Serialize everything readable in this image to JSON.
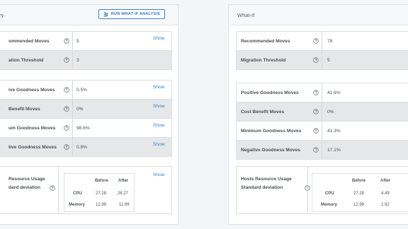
{
  "left": {
    "title": "ry",
    "run_button": "RUN WHAT-IF ANALYSIS",
    "show": "Show",
    "rows1": [
      {
        "label": "ommended Moves",
        "value": "5"
      },
      {
        "label": "ation Threshold",
        "value": "3"
      }
    ],
    "rows2": [
      {
        "label": "ive Goodness Moves",
        "value": "0.5%"
      },
      {
        "label": "Benefit Moves",
        "value": "0%"
      },
      {
        "label": "um Goodness Moves",
        "value": "98.6%"
      },
      {
        "label": "tive Goodness Moves",
        "value": "0.8%"
      }
    ],
    "usage": {
      "label_line1": "Resource Usage",
      "label_line2": "dard deviation",
      "col_before": "Before",
      "col_after": "After",
      "rows": [
        {
          "name": "CPU",
          "before": "27.28",
          "after": "26.27"
        },
        {
          "name": "Memory",
          "before": "12.99",
          "after": "11.99"
        }
      ]
    }
  },
  "right": {
    "title": "What-If",
    "rows1": [
      {
        "label": "Recommended Moves",
        "value": "78"
      },
      {
        "label": "Migration Threshold",
        "value": "5"
      }
    ],
    "rows2": [
      {
        "label": "Positive Goodness Moves",
        "value": "41.6%"
      },
      {
        "label": "Cost Benefit Moves",
        "value": "0%"
      },
      {
        "label": "Minimum Goodness Moves",
        "value": "41.3%"
      },
      {
        "label": "Negative Goodness Moves",
        "value": "17.1%"
      }
    ],
    "usage": {
      "label_line1": "Hosts Resource Usage",
      "label_line2": "Standard deviation",
      "col_before": "Before",
      "col_after": "After",
      "rows": [
        {
          "name": "CPU",
          "before": "27.28",
          "after": "4.49"
        },
        {
          "name": "Memory",
          "before": "12.99",
          "after": "1.92"
        }
      ]
    }
  },
  "colors": {
    "accent": "#2f85d0",
    "gray_row": "#e6e7e8"
  },
  "icons": {
    "help": "question-circle-icon",
    "analysis": "analysis-icon"
  }
}
